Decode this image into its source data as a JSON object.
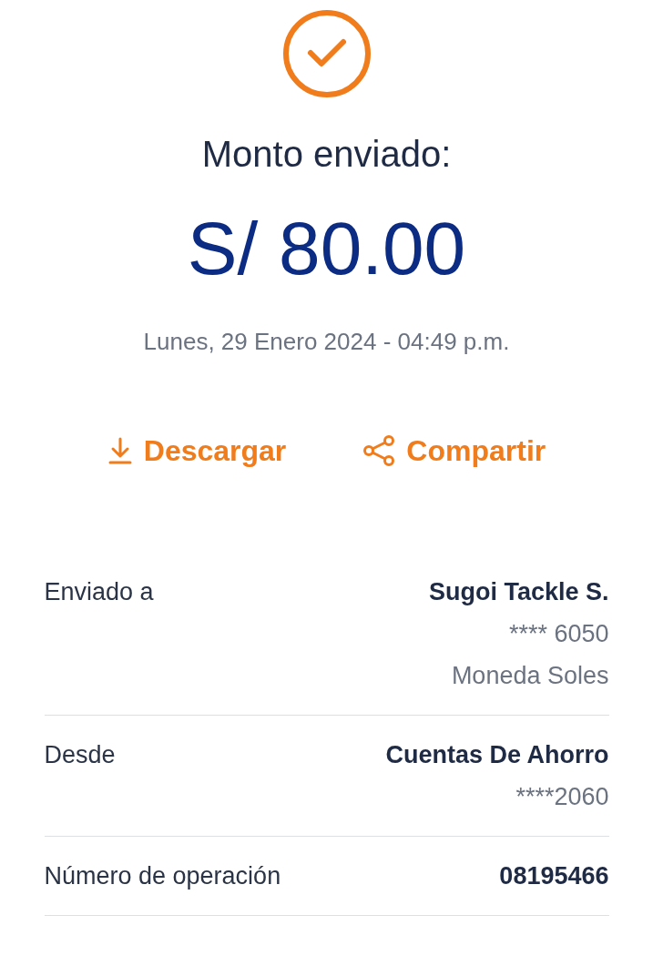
{
  "status": {
    "kind": "success"
  },
  "title": "Monto enviado:",
  "amount": "S/ 80.00",
  "date": "Lunes, 29 Enero 2024 - 04:49 p.m.",
  "actions": [
    {
      "kind": "download",
      "label": "Descargar"
    },
    {
      "kind": "share",
      "label": "Compartir"
    }
  ],
  "details": [
    {
      "label": "Enviado a",
      "lines": [
        "Sugoi Tackle S.",
        "**** 6050",
        "Moneda Soles"
      ]
    },
    {
      "label": "Desde",
      "lines": [
        "Cuentas De Ahorro",
        "****2060"
      ]
    },
    {
      "label": "Número de operación",
      "lines": [
        "08195466"
      ]
    }
  ]
}
